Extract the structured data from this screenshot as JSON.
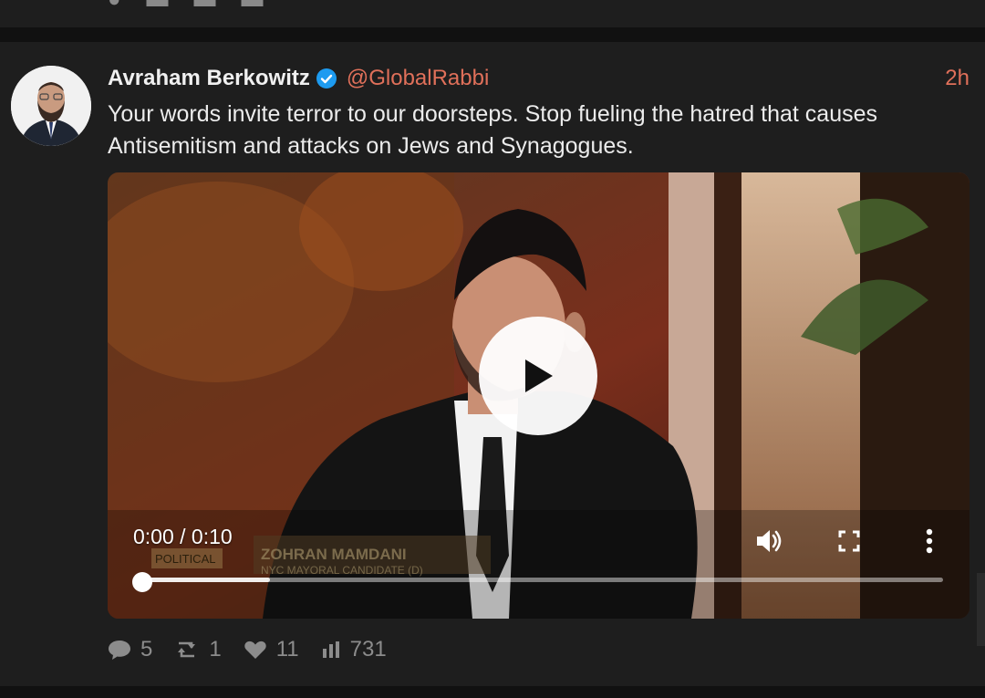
{
  "post": {
    "author": "Avraham Berkowitz",
    "handle": "@GlobalRabbi",
    "time": "2h",
    "text": "Your words invite terror to our doorsteps. Stop fueling the hatred that causes Antisemitism and attacks on Jews and Synagogues.",
    "video": {
      "time_display": "0:00 / 0:10",
      "progress": 0.0,
      "buffered": 0.16,
      "lower_third_name": "ZOHRAN MAMDANI",
      "lower_third_title": "NYC MAYORAL CANDIDATE (D)",
      "lower_third_tag": "POLITICAL"
    },
    "stats": {
      "replies": "5",
      "reposts": "1",
      "likes": "11",
      "views": "731"
    }
  },
  "icons": {
    "verified": "verified-badge-icon",
    "play": "play-icon",
    "volume": "volume-icon",
    "fullscreen": "fullscreen-icon",
    "more": "more-vertical-icon",
    "reply": "reply-bubble-icon",
    "repost": "repost-icon",
    "like": "heart-icon",
    "views": "bar-chart-icon"
  },
  "colors": {
    "accent": "#e0705a",
    "verified": "#1d9bf0",
    "background": "#1e1e1e"
  }
}
